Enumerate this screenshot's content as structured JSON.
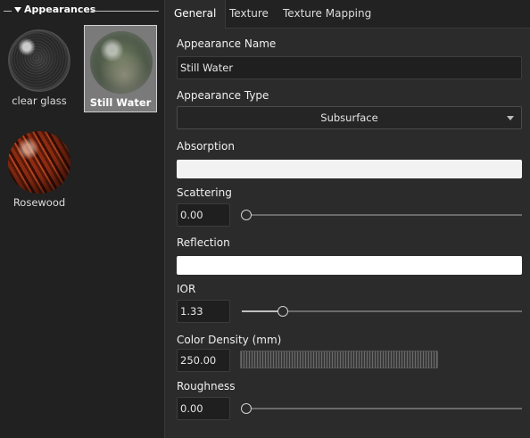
{
  "library": {
    "title": "Appearances",
    "items": [
      {
        "label": "clear glass",
        "selected": false
      },
      {
        "label": "Still Water",
        "selected": true
      },
      {
        "label": "Rosewood",
        "selected": false
      }
    ]
  },
  "tabs": [
    "General",
    "Texture",
    "Texture Mapping"
  ],
  "active_tab": "General",
  "form": {
    "appearance_name_label": "Appearance Name",
    "appearance_name_value": "Still Water",
    "appearance_type_label": "Appearance Type",
    "appearance_type_value": "Subsurface",
    "absorption_label": "Absorption",
    "absorption_color": "#f2f2f2",
    "scattering_label": "Scattering",
    "scattering_value": "0.00",
    "reflection_label": "Reflection",
    "reflection_color": "#ffffff",
    "ior_label": "IOR",
    "ior_value": "1.33",
    "color_density_label": "Color Density (mm)",
    "color_density_value": "250.00",
    "roughness_label": "Roughness",
    "roughness_value": "0.00"
  },
  "sliders": {
    "scattering_fraction": 0.0,
    "ior_fraction": 0.13,
    "roughness_fraction": 0.0
  }
}
